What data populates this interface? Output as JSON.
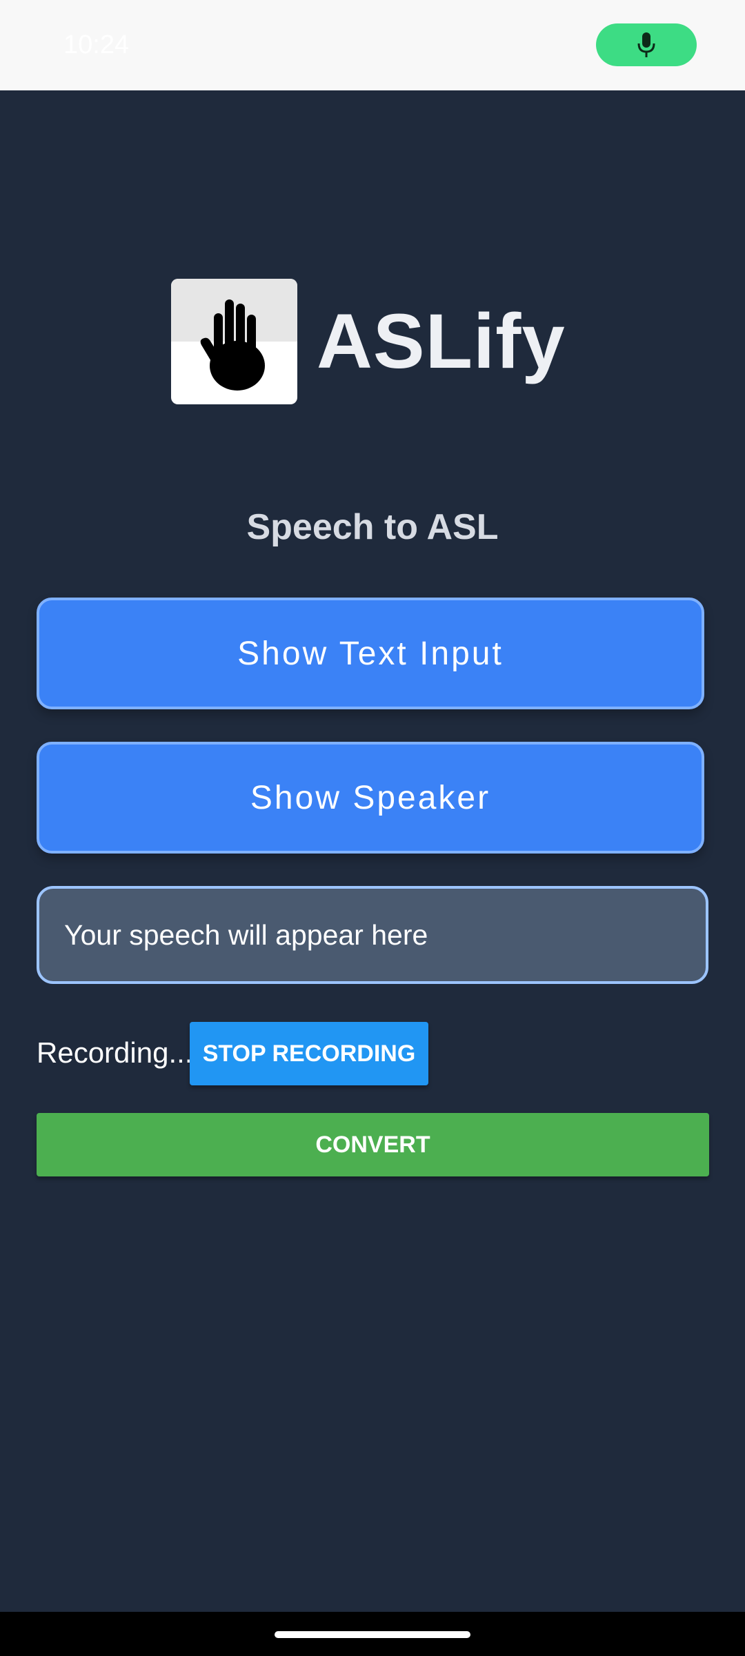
{
  "status_bar": {
    "time": "10:24",
    "mic_icon": "microphone-icon",
    "mic_color": "#3ddc84"
  },
  "header": {
    "logo_icon": "raised-hand-icon",
    "title": "ASLify"
  },
  "main": {
    "subtitle": "Speech to ASL",
    "show_text_input_label": "Show Text Input",
    "show_speaker_label": "Show Speaker",
    "speech_placeholder": "Your speech will appear here",
    "recording_status": "Recording...",
    "stop_recording_label": "STOP RECORDING",
    "convert_label": "CONVERT"
  },
  "colors": {
    "background": "#1f2a3c",
    "primary_button": "#3b82f6",
    "stop_button": "#2196f3",
    "convert_button": "#4caf50"
  }
}
